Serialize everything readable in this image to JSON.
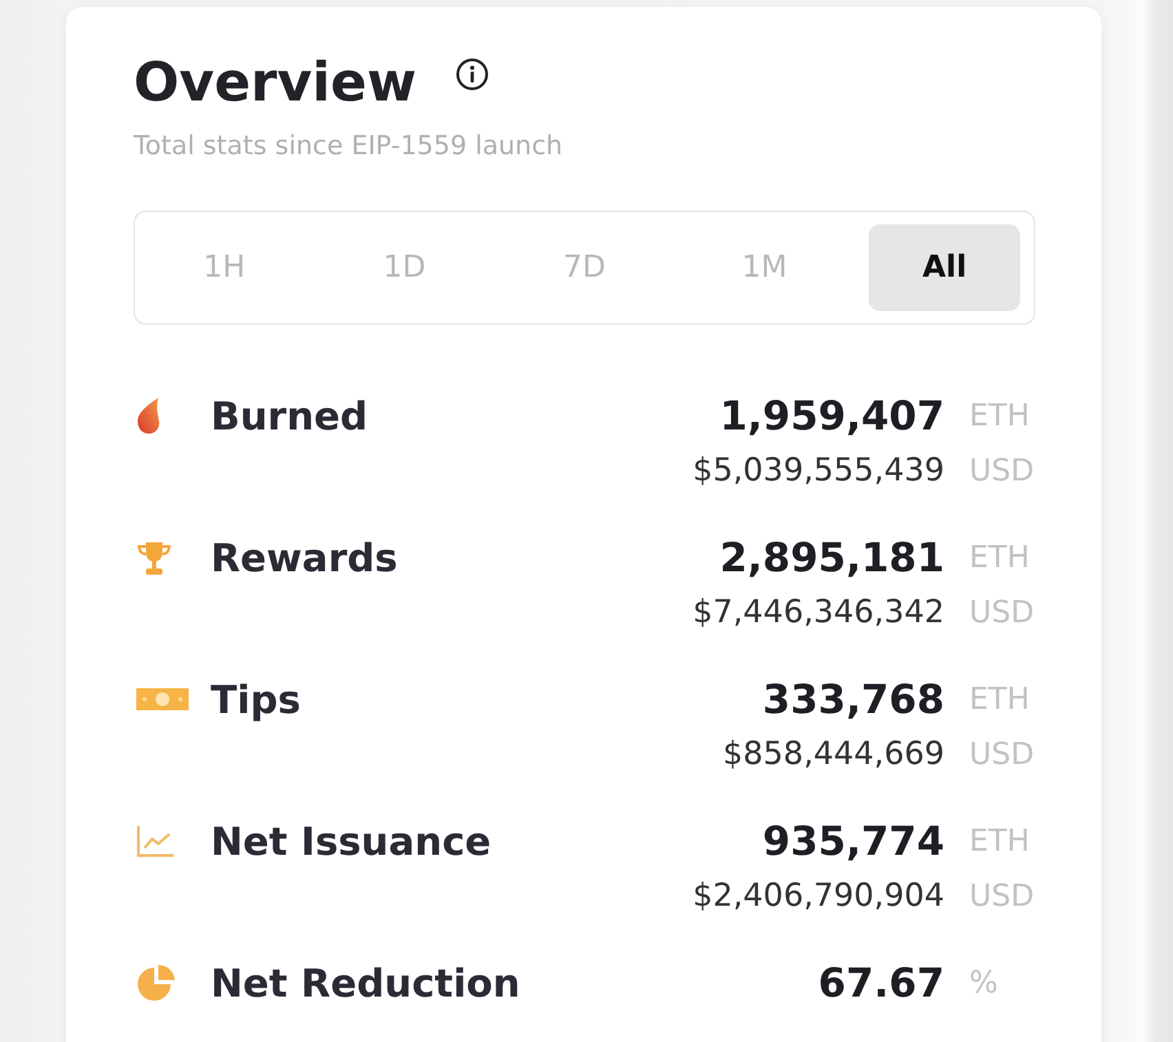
{
  "overview": {
    "title": "Overview",
    "subtitle": "Total stats since EIP-1559 launch"
  },
  "time_ranges": [
    {
      "label": "1H",
      "selected": false
    },
    {
      "label": "1D",
      "selected": false
    },
    {
      "label": "7D",
      "selected": false
    },
    {
      "label": "1M",
      "selected": false
    },
    {
      "label": "All",
      "selected": true
    }
  ],
  "stats": [
    {
      "label": "Burned",
      "value": "1,959,407",
      "unit": "ETH",
      "usd_value": "$5,039,555,439",
      "usd_unit": "USD"
    },
    {
      "label": "Rewards",
      "value": "2,895,181",
      "unit": "ETH",
      "usd_value": "$7,446,346,342",
      "usd_unit": "USD"
    },
    {
      "label": "Tips",
      "value": "333,768",
      "unit": "ETH",
      "usd_value": "$858,444,669",
      "usd_unit": "USD"
    },
    {
      "label": "Net Issuance",
      "value": "935,774",
      "unit": "ETH",
      "usd_value": "$2,406,790,904",
      "usd_unit": "USD"
    },
    {
      "label": "Net Reduction",
      "value": "67.67",
      "unit": "%"
    }
  ]
}
